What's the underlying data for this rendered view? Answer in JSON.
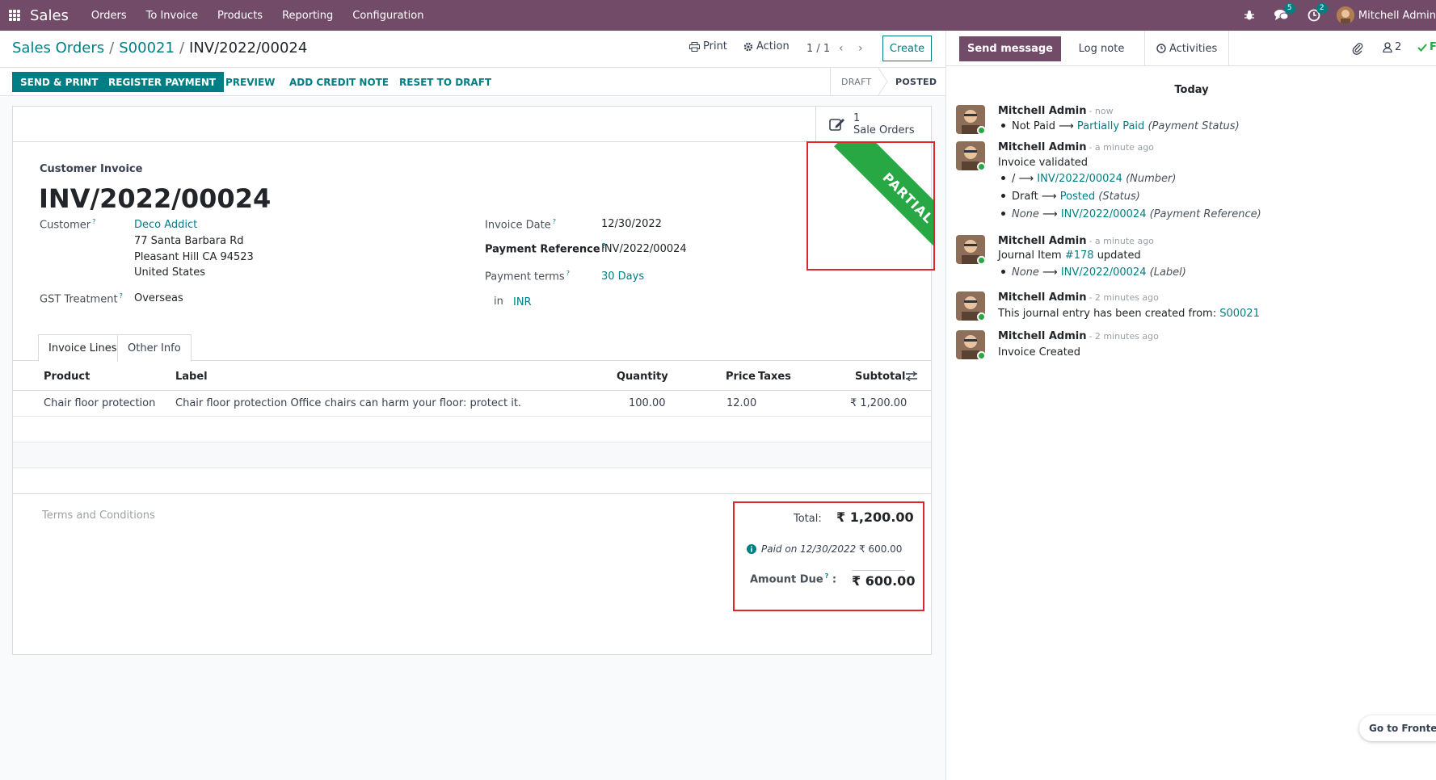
{
  "navbar": {
    "brand": "Sales",
    "menu": [
      "Orders",
      "To Invoice",
      "Products",
      "Reporting",
      "Configuration"
    ],
    "messages_count": "5",
    "activities_count": "2",
    "user": "Mitchell Admin"
  },
  "control_panel": {
    "breadcrumb": [
      "Sales Orders",
      "S00021",
      "INV/2022/00024"
    ],
    "print_label": "Print",
    "action_label": "Action",
    "pager": "1 / 1",
    "create_label": "Create"
  },
  "statusbar": {
    "buttons": [
      "SEND & PRINT",
      "REGISTER PAYMENT",
      "PREVIEW",
      "ADD CREDIT NOTE",
      "RESET TO DRAFT"
    ],
    "stages": [
      "DRAFT",
      "POSTED"
    ],
    "current_stage": "POSTED"
  },
  "smart_button": {
    "count": "1",
    "label": "Sale Orders"
  },
  "ribbon": "PARTIAL",
  "invoice": {
    "type": "Customer Invoice",
    "number": "INV/2022/00024",
    "customer_label": "Customer",
    "customer_name": "Deco Addict",
    "address": [
      "77 Santa Barbara Rd",
      "Pleasant Hill CA 94523",
      "United States"
    ],
    "gst_label": "GST Treatment",
    "gst_value": "Overseas",
    "invoice_date_label": "Invoice Date",
    "invoice_date": "12/30/2022",
    "payment_ref_label": "Payment Reference",
    "payment_ref": "INV/2022/00024",
    "payment_terms_label": "Payment terms",
    "payment_terms": "30 Days",
    "currency_prefix": "in",
    "currency": "INR"
  },
  "tabs": [
    "Invoice Lines",
    "Other Info"
  ],
  "lines": {
    "columns": [
      "Product",
      "Label",
      "Quantity",
      "Price",
      "Taxes",
      "Subtotal"
    ],
    "rows": [
      {
        "product": "Chair floor protection",
        "label": "Chair floor protection Office chairs can harm your floor: protect it.",
        "quantity": "100.00",
        "price": "12.00",
        "taxes": "",
        "subtotal": "₹ 1,200.00"
      }
    ]
  },
  "terms_placeholder": "Terms and Conditions",
  "totals": {
    "total_label": "Total:",
    "total_value": "₹ 1,200.00",
    "paid_label": "Paid on 12/30/2022",
    "paid_value": "₹ 600.00",
    "due_label": "Amount Due",
    "due_value": "₹ 600.00"
  },
  "chatter": {
    "send_message": "Send message",
    "log_note": "Log note",
    "activities": "Activities",
    "followers_count": "2",
    "follow_label": "F",
    "day_separator": "Today",
    "messages": [
      {
        "author": "Mitchell Admin",
        "time": "- now",
        "lines": [
          {
            "bullet": true,
            "old": "Not Paid",
            "new": "Partially Paid",
            "field": "(Payment Status)"
          }
        ]
      },
      {
        "author": "Mitchell Admin",
        "time": "- a minute ago",
        "body": "Invoice validated",
        "lines": [
          {
            "bullet": true,
            "old": "/",
            "new": "INV/2022/00024",
            "field": "(Number)"
          },
          {
            "bullet": true,
            "old": "Draft",
            "new": "Posted",
            "field": "(Status)"
          },
          {
            "bullet": true,
            "old": "None",
            "new": "INV/2022/00024",
            "field": "(Payment Reference)"
          }
        ]
      },
      {
        "author": "Mitchell Admin",
        "time": "- a minute ago",
        "body_prefix": "Journal Item",
        "body_link": "#178",
        "body_suffix": "updated",
        "lines": [
          {
            "bullet": true,
            "old": "None",
            "new": "INV/2022/00024",
            "field": "(Label)"
          }
        ]
      },
      {
        "author": "Mitchell Admin",
        "time": "- 2 minutes ago",
        "body_prefix": "This journal entry has been created from:",
        "body_link": "S00021"
      },
      {
        "author": "Mitchell Admin",
        "time": "- 2 minutes ago",
        "body": "Invoice Created"
      }
    ]
  },
  "frontend_button": "Go to Frontend",
  "colors": {
    "brand": "#714b67",
    "accent": "#017e84",
    "ribbon": "#28a745",
    "highlight_border": "#e0262b"
  }
}
